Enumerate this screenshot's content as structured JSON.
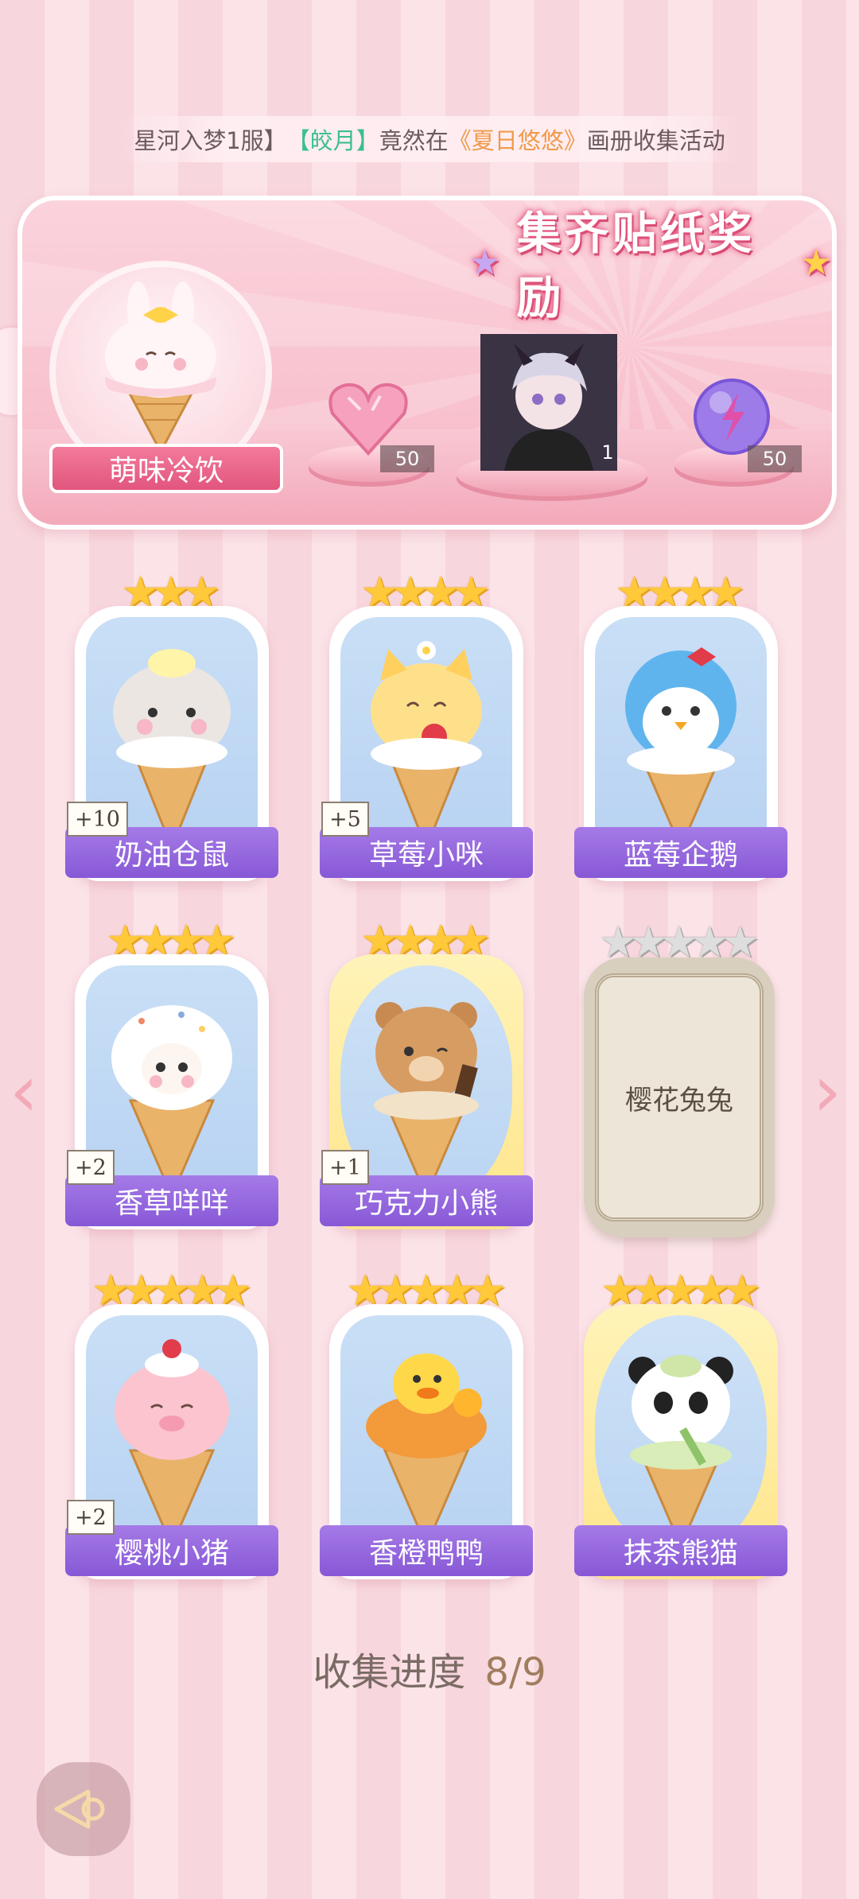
{
  "marquee": {
    "part1": "星河入梦1服】",
    "part2": "【皎月】",
    "part3": "竟然在",
    "part4": "《夏日悠悠》",
    "part5": "画册收集活动"
  },
  "reward_panel": {
    "title": "集齐贴纸奖励",
    "album_name": "萌味冷饮",
    "rewards": [
      {
        "icon": "pink-heart-gem-icon",
        "count": "50"
      },
      {
        "icon": "avatar-portrait",
        "count": "1"
      },
      {
        "icon": "purple-energy-orb-icon",
        "count": "50"
      }
    ]
  },
  "cards": [
    {
      "name": "奶油仓鼠",
      "stars": 3,
      "bonus": "+10",
      "collected": true
    },
    {
      "name": "草莓小咪",
      "stars": 4,
      "bonus": "+5",
      "collected": true
    },
    {
      "name": "蓝莓企鹅",
      "stars": 4,
      "bonus": "",
      "collected": true
    },
    {
      "name": "香草咩咩",
      "stars": 4,
      "bonus": "+2",
      "collected": true
    },
    {
      "name": "巧克力小熊",
      "stars": 4,
      "bonus": "+1",
      "collected": true
    },
    {
      "name": "樱花兔兔",
      "stars": 5,
      "bonus": "",
      "collected": false
    },
    {
      "name": "樱桃小猪",
      "stars": 5,
      "bonus": "+2",
      "collected": true
    },
    {
      "name": "香橙鸭鸭",
      "stars": 5,
      "bonus": "",
      "collected": true
    },
    {
      "name": "抹茶熊猫",
      "stars": 5,
      "bonus": "",
      "collected": true
    }
  ],
  "progress": {
    "label": "收集进度",
    "value": "8/9"
  },
  "nav": {
    "prev_icon": "chevron-left-icon",
    "next_icon": "chevron-right-icon",
    "back_icon": "back-arrow-icon"
  }
}
